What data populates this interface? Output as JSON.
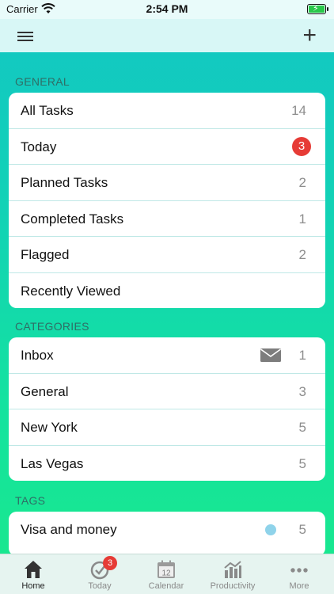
{
  "status_bar": {
    "carrier": "Carrier",
    "time": "2:54 PM"
  },
  "general": {
    "title": "GENERAL",
    "items": [
      {
        "label": "All Tasks",
        "count": "14"
      },
      {
        "label": "Today",
        "badge": "3"
      },
      {
        "label": "Planned Tasks",
        "count": "2"
      },
      {
        "label": "Completed Tasks",
        "count": "1"
      },
      {
        "label": "Flagged",
        "count": "2"
      },
      {
        "label": "Recently Viewed"
      }
    ]
  },
  "categories": {
    "title": "CATEGORIES",
    "items": [
      {
        "label": "Inbox",
        "count": "1"
      },
      {
        "label": "General",
        "count": "3"
      },
      {
        "label": "New York",
        "count": "5"
      },
      {
        "label": "Las Vegas",
        "count": "5"
      }
    ]
  },
  "tags": {
    "title": "TAGS",
    "items": [
      {
        "label": "Visa and money",
        "count": "5",
        "dot_color": "#8fd3ea"
      }
    ]
  },
  "tabbar": {
    "tabs": [
      {
        "label": "Home",
        "icon": "home-icon"
      },
      {
        "label": "Today",
        "icon": "today-check-icon",
        "badge": "3"
      },
      {
        "label": "Calendar",
        "icon": "calendar-icon",
        "icon_text": "12"
      },
      {
        "label": "Productivity",
        "icon": "productivity-icon"
      },
      {
        "label": "More",
        "icon": "more-icon"
      }
    ]
  }
}
